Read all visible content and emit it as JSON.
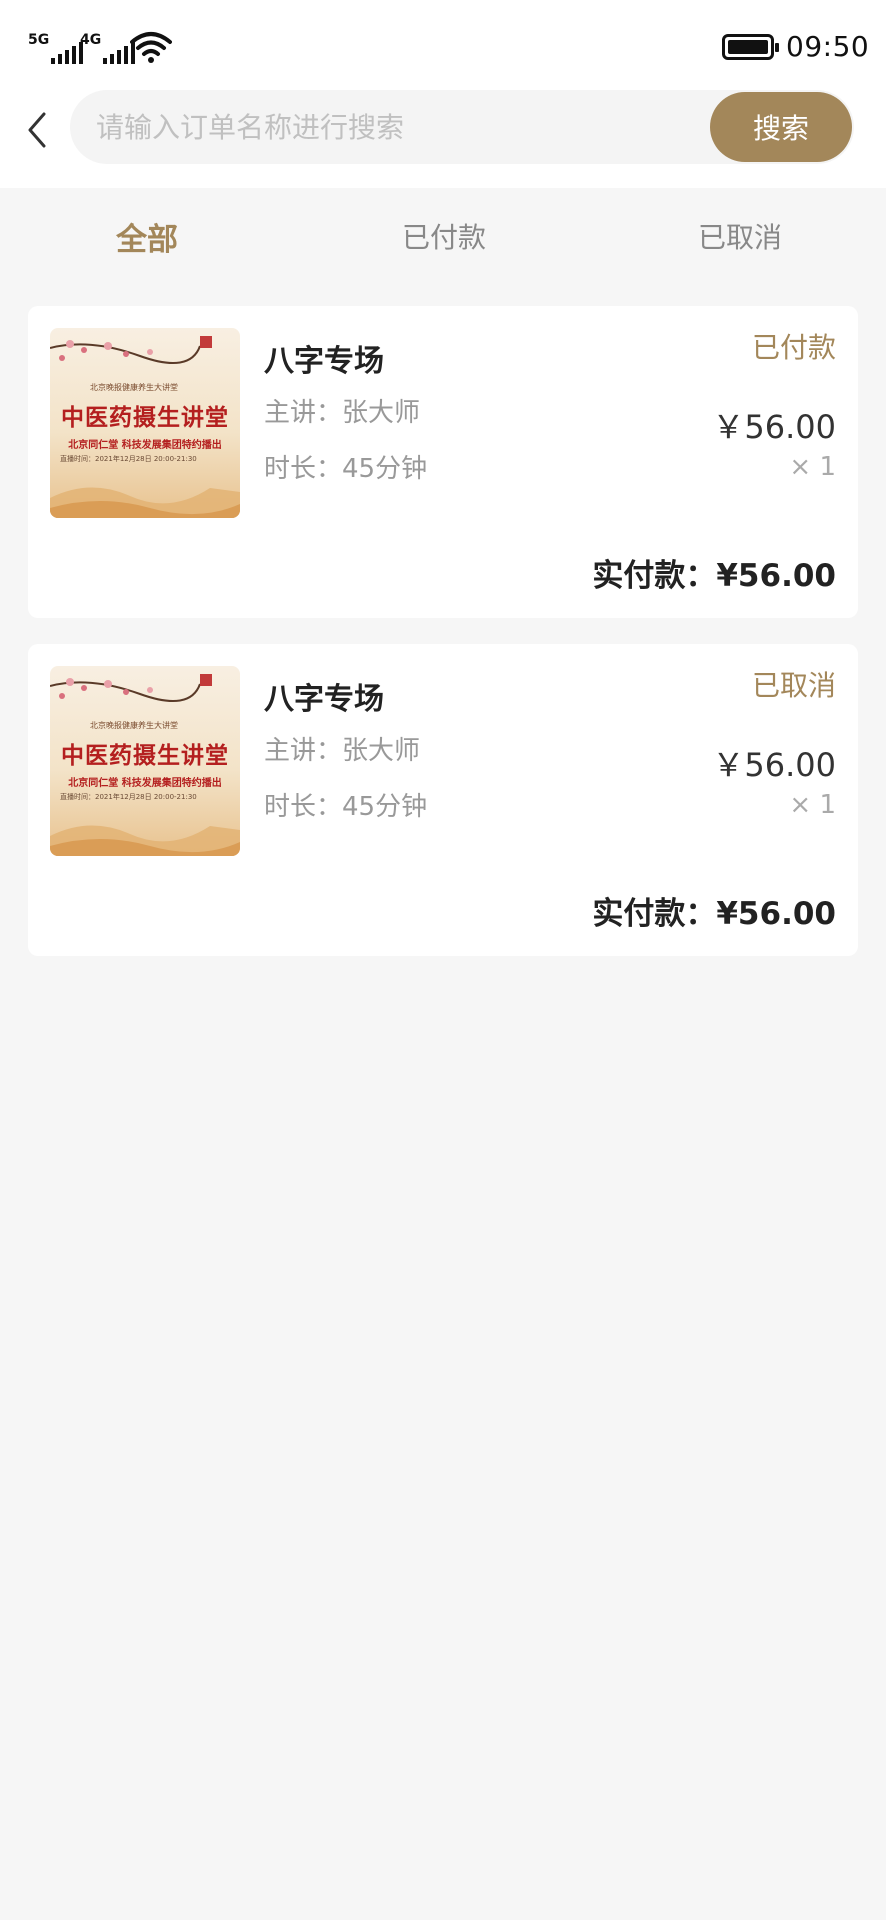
{
  "status_bar": {
    "signal1_label": "5G",
    "signal2_label": "4G",
    "time": "09:50"
  },
  "search": {
    "placeholder": "请输入订单名称进行搜索",
    "button_label": "搜索"
  },
  "tabs": [
    {
      "label": "全部",
      "active": true
    },
    {
      "label": "已付款",
      "active": false
    },
    {
      "label": "已取消",
      "active": false
    }
  ],
  "poster": {
    "small_text": "北京晚报健康养生大讲堂",
    "big_text": "中医药摄生讲堂",
    "sub_text": "北京同仁堂 科技发展集团特约播出",
    "time_text": "直播时间：2021年12月28日 20:00-21:30"
  },
  "orders": [
    {
      "title": "八字专场",
      "lecturer": "主讲：张大师",
      "duration": "时长：45分钟",
      "status": "已付款",
      "price": "￥56.00",
      "quantity": "× 1",
      "total": "实付款：¥56.00"
    },
    {
      "title": "八字专场",
      "lecturer": "主讲：张大师",
      "duration": "时长：45分钟",
      "status": "已取消",
      "price": "￥56.00",
      "quantity": "× 1",
      "total": "实付款：¥56.00"
    }
  ],
  "colors": {
    "accent": "#a3875a",
    "background": "#f6f6f6",
    "card": "#ffffff"
  }
}
